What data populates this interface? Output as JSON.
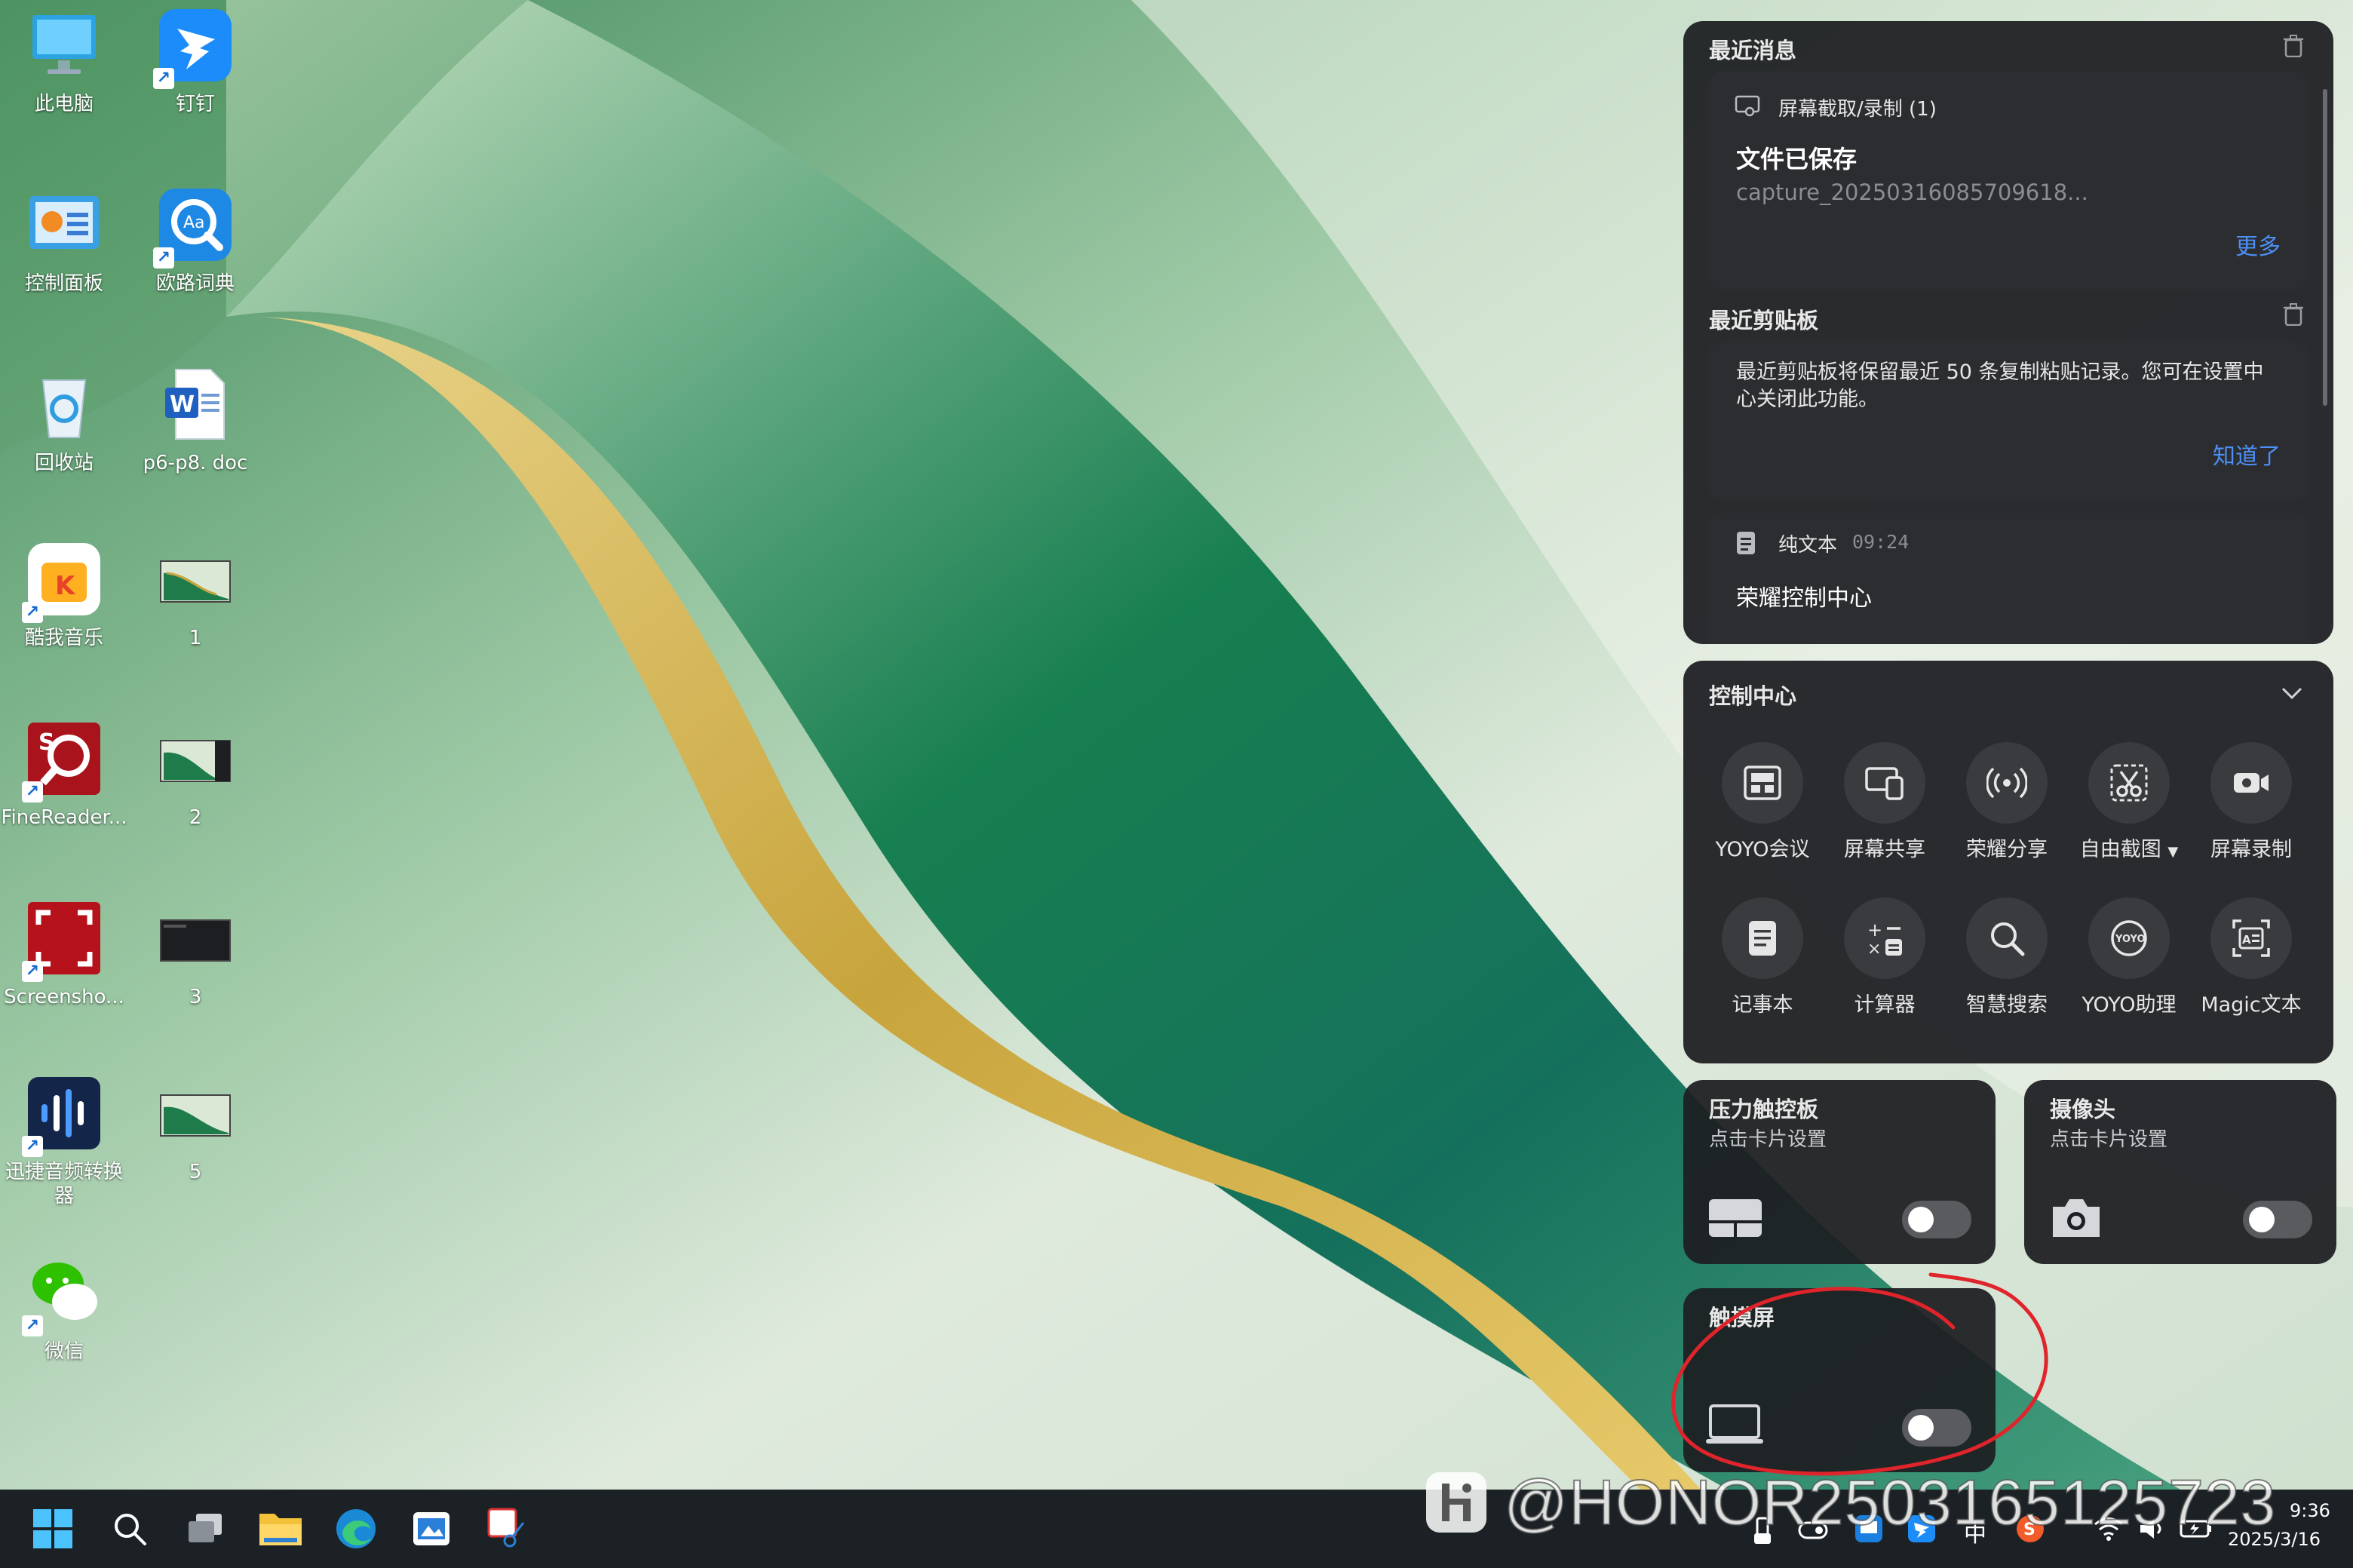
{
  "desktop": {
    "icons": [
      {
        "label": "此电脑",
        "icon": "computer-icon"
      },
      {
        "label": "钉钉",
        "icon": "dingtalk-icon"
      },
      {
        "label": "控制面板",
        "icon": "control-panel-icon"
      },
      {
        "label": "欧路词典",
        "icon": "eudic-icon"
      },
      {
        "label": "回收站",
        "icon": "recycle-bin-icon"
      },
      {
        "label": "p6-p8. doc",
        "icon": "word-doc-icon"
      },
      {
        "label": "酷我音乐",
        "icon": "kuwo-music-icon"
      },
      {
        "label": "1",
        "icon": "image-thumbnail-icon"
      },
      {
        "label": "FineReader...",
        "icon": "finereader-icon"
      },
      {
        "label": "2",
        "icon": "image-thumbnail-icon"
      },
      {
        "label": "Screensho...",
        "icon": "screenshot-tool-icon"
      },
      {
        "label": "3",
        "icon": "image-thumbnail-icon"
      },
      {
        "label": "迅捷音频转换器",
        "icon": "audio-converter-icon"
      },
      {
        "label": "5",
        "icon": "image-thumbnail-icon"
      },
      {
        "label": "微信",
        "icon": "wechat-icon"
      }
    ]
  },
  "recent": {
    "title": "最近消息",
    "notification": {
      "app": "屏幕截取/录制 (1)",
      "heading": "文件已保存",
      "file": "capture_2025031608570961​8...",
      "more": "更多"
    }
  },
  "clipboard": {
    "title": "最近剪贴板",
    "info": "最近剪贴板将保留最近 50 条复制粘贴记录。您可在设置中心关闭此功能。",
    "ack": "知道了",
    "entry": {
      "type": "纯文本",
      "time": "09:24",
      "text": "荣耀控制中心"
    }
  },
  "control_center": {
    "title": "控制中心",
    "tiles": [
      {
        "label": "YOYO会议",
        "icon": "meeting-icon"
      },
      {
        "label": "屏幕共享",
        "icon": "screen-share-icon"
      },
      {
        "label": "荣耀分享",
        "icon": "honor-share-icon"
      },
      {
        "label": "自由截图",
        "icon": "scissors-icon"
      },
      {
        "label": "屏幕录制",
        "icon": "screen-record-icon"
      },
      {
        "label": "记事本",
        "icon": "notepad-icon"
      },
      {
        "label": "计算器",
        "icon": "calculator-icon"
      },
      {
        "label": "智慧搜索",
        "icon": "search-icon"
      },
      {
        "label": "YOYO助理",
        "icon": "yoyo-assistant-icon"
      },
      {
        "label": "Magic文本",
        "icon": "magic-text-icon"
      }
    ]
  },
  "cards": {
    "touchpad": {
      "title": "压力触控板",
      "sub": "点击卡片设置",
      "on": false
    },
    "camera": {
      "title": "摄像头",
      "sub": "点击卡片设置",
      "on": false
    },
    "touchscreen": {
      "title": "触摸屏",
      "on": false
    }
  },
  "watermark": "@HONOR250316512572​3",
  "taskbar": {
    "ime": "中",
    "time": "9:36",
    "date": "2025/3/16"
  },
  "colors": {
    "accent": "#4d8ff5",
    "panel": "#1e1f22",
    "annotation": "#e0242b"
  }
}
